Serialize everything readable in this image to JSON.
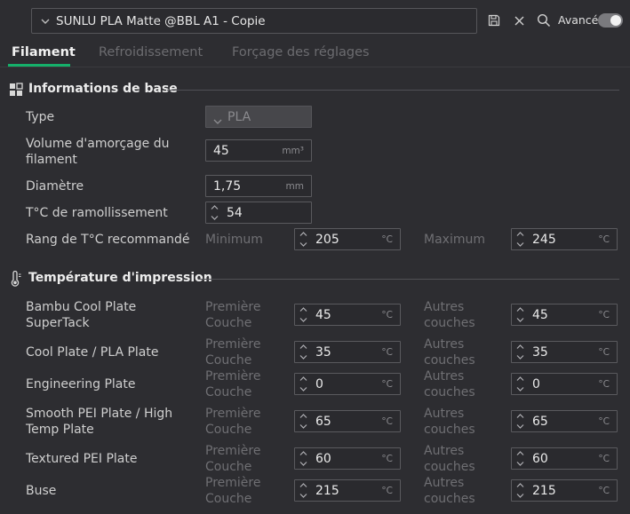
{
  "header": {
    "preset_name": "SUNLU PLA Matte @BBL A1 - Copie",
    "advanced_label": "Avancé",
    "advanced_on": false,
    "icons": [
      "chevron-down-icon",
      "save-icon",
      "close-icon",
      "search-icon"
    ]
  },
  "tabs": [
    {
      "label": "Filament",
      "active": true
    },
    {
      "label": "Refroidissement",
      "active": false
    },
    {
      "label": "Forçage des réglages",
      "active": false
    }
  ],
  "basic": {
    "title": "Informations de base",
    "type_label": "Type",
    "type_value": "PLA",
    "prime_label": "Volume d'amorçage du filament",
    "prime_value": "45",
    "prime_unit": "mm³",
    "diameter_label": "Diamètre",
    "diameter_value": "1,75",
    "diameter_unit": "mm",
    "soften_label": "T°C de ramollissement",
    "soften_value": "54",
    "range_label": "Rang de T°C recommandé",
    "range_min_label": "Minimum",
    "range_min_value": "205",
    "range_max_label": "Maximum",
    "range_max_value": "245",
    "temp_unit": "°C"
  },
  "print_temp": {
    "title": "Température d'impression",
    "first_label": "Première Couche",
    "other_label": "Autres couches",
    "unit": "°C",
    "plates": [
      {
        "name": "Bambu Cool Plate SuperTack",
        "first": "45",
        "other": "45"
      },
      {
        "name": "Cool Plate / PLA Plate",
        "first": "35",
        "other": "35"
      },
      {
        "name": "Engineering Plate",
        "first": "0",
        "other": "0"
      },
      {
        "name": "Smooth PEI Plate / High Temp Plate",
        "first": "65",
        "other": "65"
      },
      {
        "name": "Textured PEI Plate",
        "first": "60",
        "other": "60"
      },
      {
        "name": "Buse",
        "first": "215",
        "other": "215"
      }
    ]
  }
}
